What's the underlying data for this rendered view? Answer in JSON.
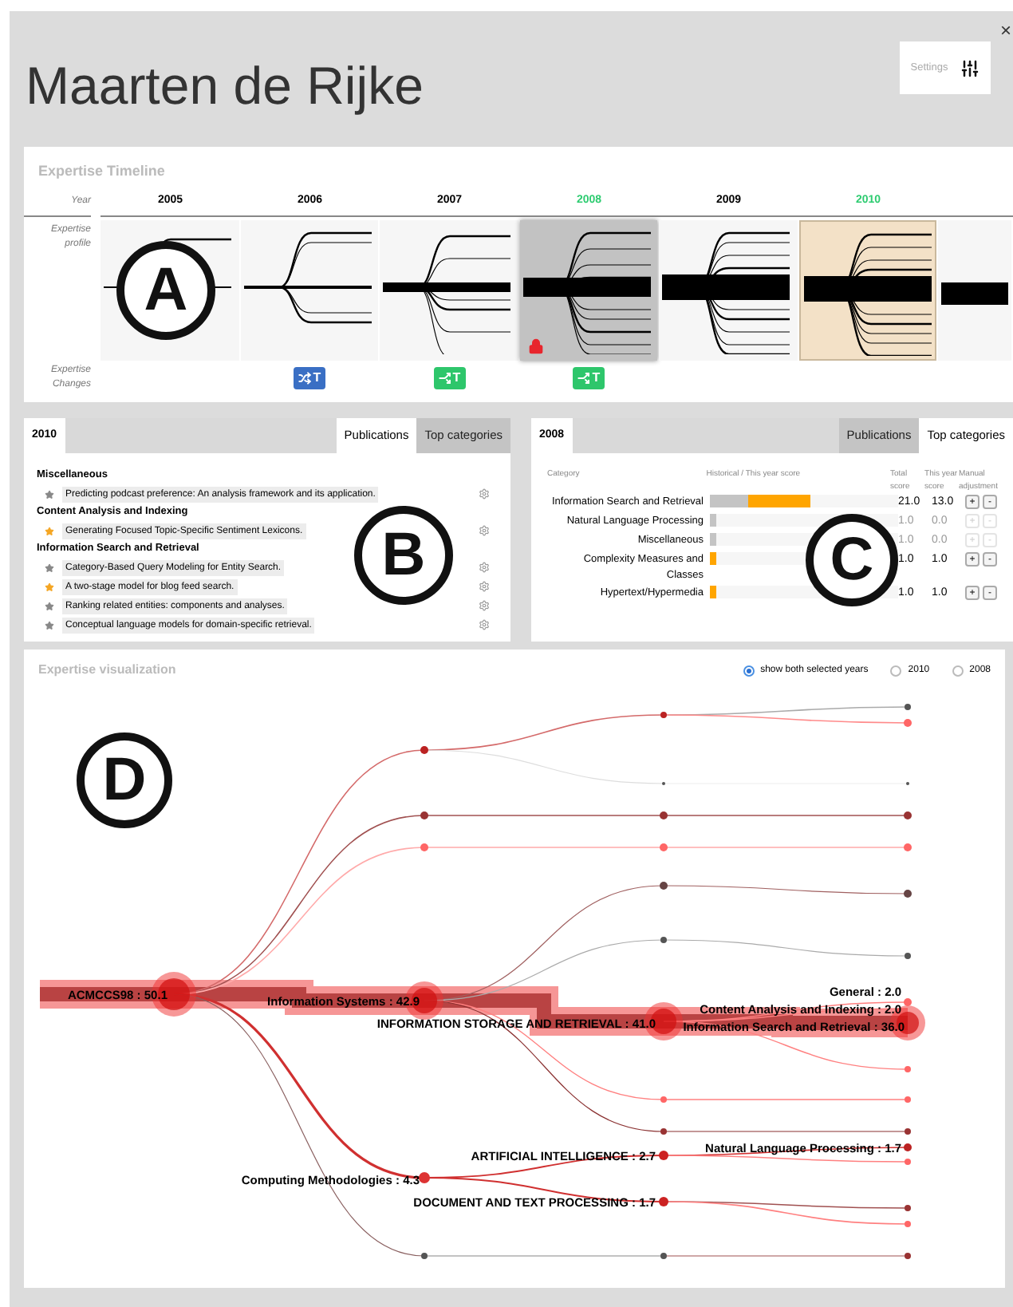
{
  "window": {
    "close": "×"
  },
  "header": {
    "title": "Maarten de Rijke",
    "settings_label": "Settings"
  },
  "timeline": {
    "title": "Expertise Timeline",
    "marker": "A",
    "row_labels": [
      "Year",
      "Expertise profile",
      "Expertise Changes"
    ],
    "years": [
      {
        "year": "2005",
        "selected": false,
        "locked": false
      },
      {
        "year": "2006",
        "selected": false,
        "locked": false,
        "change": {
          "kind": "shuffle",
          "label": "T"
        }
      },
      {
        "year": "2007",
        "selected": false,
        "locked": false,
        "change": {
          "kind": "split",
          "label": "T"
        }
      },
      {
        "year": "2008",
        "selected": true,
        "locked": true,
        "change": {
          "kind": "split",
          "label": "T"
        }
      },
      {
        "year": "2009",
        "selected": false,
        "locked": false
      },
      {
        "year": "2010",
        "selected": true,
        "locked": false
      }
    ]
  },
  "publications_panel": {
    "year": "2010",
    "marker": "B",
    "tabs": [
      {
        "label": "Publications",
        "selected": true
      },
      {
        "label": "Top categories",
        "selected": false
      }
    ],
    "groups": [
      {
        "name": "Miscellaneous",
        "items": [
          {
            "title": "Predicting podcast preference: An analysis framework and its application.",
            "starred": false
          }
        ]
      },
      {
        "name": "Content Analysis and Indexing",
        "items": [
          {
            "title": "Generating Focused Topic-Specific Sentiment Lexicons.",
            "starred": true
          }
        ]
      },
      {
        "name": "Information Search and Retrieval",
        "items": [
          {
            "title": "Category-Based Query Modeling for Entity Search.",
            "starred": false
          },
          {
            "title": "A two-stage model for blog feed search.",
            "starred": true
          },
          {
            "title": "Ranking related entities: components and analyses.",
            "starred": false
          },
          {
            "title": "Conceptual language models for domain-specific retrieval.",
            "starred": false
          }
        ]
      }
    ]
  },
  "categories_panel": {
    "year": "2008",
    "marker": "C",
    "tabs": [
      {
        "label": "Publications",
        "selected": false
      },
      {
        "label": "Top categories",
        "selected": true
      }
    ],
    "columns": [
      "Category",
      "Historical / This year score",
      "Total score",
      "This year score",
      "Manual adjustment"
    ],
    "rows": [
      {
        "name": "Information Search and Retrieval",
        "bars": [
          {
            "kind": "historical",
            "level": 0.2
          },
          {
            "kind": "this_year",
            "level": 0.33
          }
        ],
        "total": "21.0",
        "this_year": "13.0",
        "adjustable": true,
        "buttons": [
          "+",
          "-"
        ]
      },
      {
        "name": "Natural Language Processing",
        "bars": [
          {
            "kind": "historical",
            "level": 0.03
          }
        ],
        "total": "1.0",
        "this_year": "0.0",
        "adjustable": false,
        "buttons": [
          "+",
          "-"
        ]
      },
      {
        "name": "Miscellaneous",
        "bars": [
          {
            "kind": "historical",
            "level": 0.03
          }
        ],
        "total": "1.0",
        "this_year": "0.0",
        "adjustable": false,
        "buttons": [
          "+",
          "-"
        ]
      },
      {
        "name": "Complexity Measures and Classes",
        "bars": [
          {
            "kind": "this_year",
            "level": 0.03
          }
        ],
        "total": "1.0",
        "this_year": "1.0",
        "adjustable": true,
        "buttons": [
          "+",
          "-"
        ]
      },
      {
        "name": "Hypertext/Hypermedia",
        "bars": [
          {
            "kind": "this_year",
            "level": 0.03
          }
        ],
        "total": "1.0",
        "this_year": "1.0",
        "adjustable": true,
        "buttons": [
          "+",
          "-"
        ]
      }
    ]
  },
  "visualization": {
    "title": "Expertise visualization",
    "marker": "D",
    "options": [
      {
        "label": "show both selected years",
        "selected": true
      },
      {
        "label": "2010",
        "selected": false
      },
      {
        "label": "2008",
        "selected": false
      }
    ],
    "node_labels": [
      "General : 2.0",
      "ACMCCS98 : 50.1",
      "Information Systems : 42.9",
      "Content Analysis and Indexing : 2.0",
      "INFORMATION STORAGE AND RETRIEVAL : 41.0",
      "Information Search and Retrieval : 36.0",
      "Natural Language Processing : 1.7",
      "ARTIFICIAL INTELLIGENCE : 2.7",
      "Computing Methodologies : 4.3",
      "DOCUMENT AND TEXT PROCESSING : 1.7"
    ]
  }
}
